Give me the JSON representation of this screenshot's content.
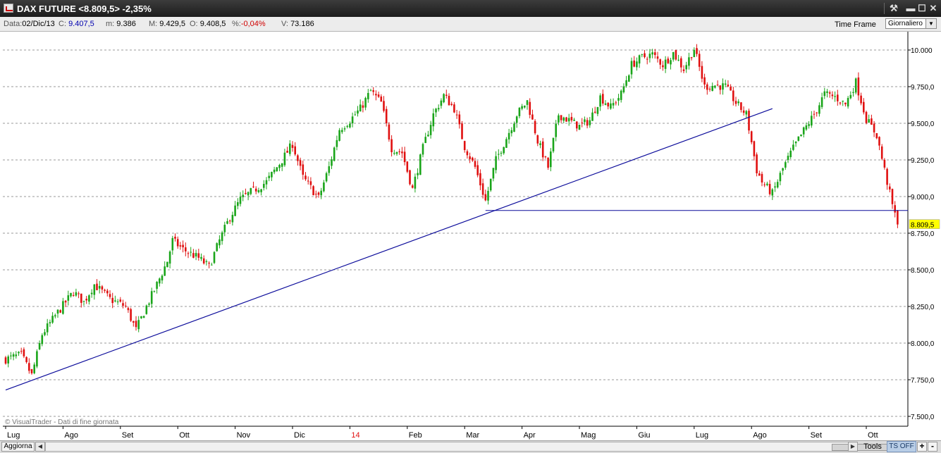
{
  "window": {
    "title": "DAX FUTURE <8.809,5> -2,35%",
    "controls": {
      "tools": "⚒",
      "minimize": "▬",
      "maximize": "☐",
      "close": "✕"
    }
  },
  "info": {
    "date_label": "Data:",
    "date_value": "02/Dic/13",
    "close_label": "C:",
    "close_value": "9.407,5",
    "min_label": "m:",
    "min_value": "9.386",
    "max_label": "M:",
    "max_value": "9.429,5",
    "open_label": "O:",
    "open_value": "9.408,5",
    "pct_label": "%:",
    "pct_value": "-0,04%",
    "vol_label": "V:",
    "vol_value": "73.186",
    "timeframe_label": "Time Frame",
    "timeframe_value": "Giornaliero"
  },
  "chart_data": {
    "type": "candlestick",
    "y_ticks": [
      "10.000",
      "9.750,0",
      "9.500,0",
      "9.250,0",
      "9.000,0",
      "8.750,0",
      "8.500,0",
      "8.250,0",
      "8.000,0",
      "7.750,0",
      "7.500,0"
    ],
    "y_tick_values": [
      10000,
      9750,
      9500,
      9250,
      9000,
      8750,
      8500,
      8250,
      8000,
      7750,
      7500
    ],
    "ylim": [
      7450,
      10140
    ],
    "grid": "horizontal dashed",
    "x_labels": [
      "Lug",
      "Ago",
      "Set",
      "Ott",
      "Nov",
      "Dic",
      "14",
      "Feb",
      "Mar",
      "Apr",
      "Mag",
      "Giu",
      "Lug",
      "Ago",
      "Set",
      "Ott"
    ],
    "x_label_index": [
      0,
      22,
      44,
      66,
      88,
      110,
      132,
      154,
      176,
      198,
      220,
      242,
      264,
      286,
      308,
      330
    ],
    "highlight_label": "14",
    "last_price": 8809.5,
    "last_price_label": "8.809,5",
    "close_path": [
      [
        0,
        7890
      ],
      [
        6,
        7920
      ],
      [
        10,
        7780
      ],
      [
        14,
        8060
      ],
      [
        20,
        8210
      ],
      [
        26,
        8350
      ],
      [
        30,
        8280
      ],
      [
        34,
        8400
      ],
      [
        40,
        8300
      ],
      [
        46,
        8250
      ],
      [
        50,
        8090
      ],
      [
        54,
        8250
      ],
      [
        58,
        8400
      ],
      [
        62,
        8560
      ],
      [
        64,
        8700
      ],
      [
        68,
        8640
      ],
      [
        74,
        8580
      ],
      [
        78,
        8520
      ],
      [
        82,
        8700
      ],
      [
        86,
        8860
      ],
      [
        90,
        8980
      ],
      [
        94,
        9030
      ],
      [
        100,
        9100
      ],
      [
        106,
        9250
      ],
      [
        110,
        9360
      ],
      [
        114,
        9130
      ],
      [
        120,
        8990
      ],
      [
        124,
        9200
      ],
      [
        128,
        9460
      ],
      [
        132,
        9520
      ],
      [
        136,
        9600
      ],
      [
        140,
        9720
      ],
      [
        144,
        9640
      ],
      [
        148,
        9330
      ],
      [
        152,
        9300
      ],
      [
        156,
        9050
      ],
      [
        160,
        9330
      ],
      [
        164,
        9560
      ],
      [
        168,
        9690
      ],
      [
        172,
        9600
      ],
      [
        176,
        9340
      ],
      [
        180,
        9200
      ],
      [
        184,
        8970
      ],
      [
        188,
        9250
      ],
      [
        192,
        9400
      ],
      [
        196,
        9560
      ],
      [
        200,
        9650
      ],
      [
        204,
        9380
      ],
      [
        208,
        9200
      ],
      [
        212,
        9560
      ],
      [
        216,
        9520
      ],
      [
        220,
        9480
      ],
      [
        224,
        9520
      ],
      [
        228,
        9680
      ],
      [
        232,
        9610
      ],
      [
        236,
        9700
      ],
      [
        240,
        9900
      ],
      [
        244,
        9950
      ],
      [
        248,
        9970
      ],
      [
        252,
        9900
      ],
      [
        256,
        9980
      ],
      [
        260,
        9870
      ],
      [
        264,
        10010
      ],
      [
        268,
        9750
      ],
      [
        272,
        9760
      ],
      [
        276,
        9750
      ],
      [
        280,
        9640
      ],
      [
        284,
        9560
      ],
      [
        288,
        9180
      ],
      [
        290,
        9100
      ],
      [
        294,
        9020
      ],
      [
        298,
        9190
      ],
      [
        302,
        9330
      ],
      [
        306,
        9450
      ],
      [
        310,
        9560
      ],
      [
        314,
        9700
      ],
      [
        318,
        9680
      ],
      [
        322,
        9630
      ],
      [
        326,
        9780
      ],
      [
        330,
        9530
      ],
      [
        334,
        9420
      ],
      [
        336,
        9260
      ],
      [
        340,
        8940
      ],
      [
        342,
        8809
      ]
    ],
    "trendlines": [
      {
        "from": [
          0,
          7680
        ],
        "to": [
          294,
          9600
        ]
      },
      {
        "from": [
          184,
          8905
        ],
        "to": [
          346,
          8905
        ]
      }
    ],
    "source_note": "© VisualTrader - Dati di fine giornata"
  },
  "colors": {
    "up": "#1aa51a",
    "down": "#e01010",
    "trendline": "#0a0a9a",
    "grid": "#9a9a9a",
    "last_price_bg": "#ffff00"
  },
  "footer": {
    "update_button": "Aggiorna",
    "tools_button": "Tools",
    "ts_button": "TS OFF",
    "plus_button": "+",
    "minus_button": "-"
  }
}
